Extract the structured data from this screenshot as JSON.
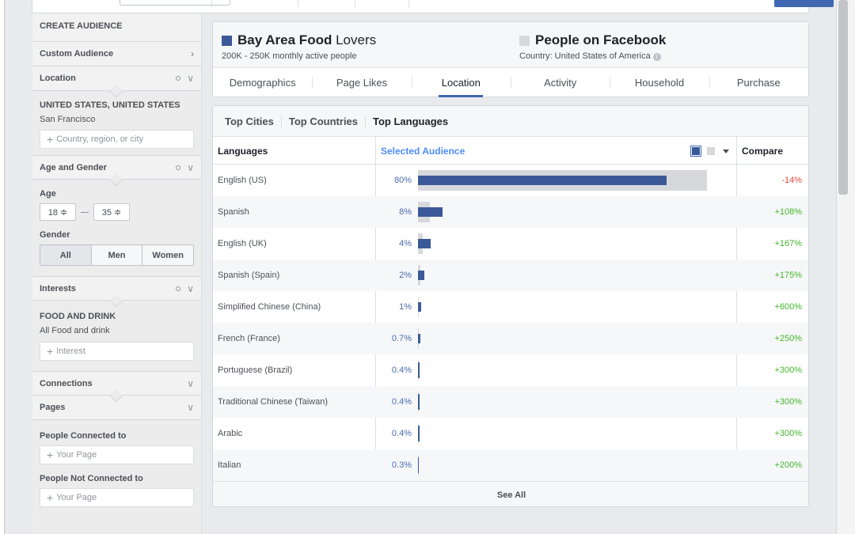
{
  "colors": {
    "selected_audience": "#3b5998",
    "comparison": "#d6d8dc",
    "accent": "#4267b2",
    "negative": "#e2473f",
    "positive": "#42b72a"
  },
  "sidebar": {
    "header": "CREATE AUDIENCE",
    "custom_audience": "Custom Audience",
    "location": {
      "label": "Location",
      "country": "UNITED STATES, UNITED STATES",
      "city": "San Francisco",
      "input_placeholder": "Country, region, or city"
    },
    "age_gender": {
      "label": "Age and Gender",
      "age_label": "Age",
      "age_min": "18 ≑",
      "age_max": "35 ≑",
      "gender_label": "Gender",
      "gender_options": [
        "All",
        "Men",
        "Women"
      ]
    },
    "interests": {
      "label": "Interests",
      "category": "FOOD AND DRINK",
      "selection": "All Food and drink",
      "input_placeholder": "Interest"
    },
    "connections": "Connections",
    "pages": {
      "label": "Pages",
      "connected_label": "People Connected to",
      "connected_placeholder": "Your Page",
      "not_connected_label": "People Not Connected to",
      "not_connected_placeholder": "Your Page"
    }
  },
  "header": {
    "audience_name_bold": "Bay Area Food",
    "audience_name_light": "Lovers",
    "audience_size": "200K - 250K monthly active people",
    "compare_name": "People on Facebook",
    "compare_country": "Country: United States of America",
    "tabs": [
      "Demographics",
      "Page Likes",
      "Location",
      "Activity",
      "Household",
      "Purchase"
    ],
    "active_tab": "Location"
  },
  "panel": {
    "subtabs": [
      "Top Cities",
      "Top Countries",
      "Top Languages"
    ],
    "active_subtab": "Top Languages",
    "col_languages": "Languages",
    "col_selected": "Selected Audience",
    "col_compare": "Compare",
    "see_all": "See All"
  },
  "chart_data": {
    "type": "bar",
    "categories": [
      "English (US)",
      "Spanish",
      "English (UK)",
      "Spanish (Spain)",
      "Simplified Chinese (China)",
      "French (France)",
      "Portuguese (Brazil)",
      "Traditional Chinese (Taiwan)",
      "Arabic",
      "Italian"
    ],
    "series": [
      {
        "name": "Selected Audience",
        "values": [
          80,
          8,
          4,
          2,
          1,
          0.7,
          0.4,
          0.4,
          0.4,
          0.3
        ]
      },
      {
        "values": [
          93,
          3.8,
          1.5,
          0.7,
          0.14,
          0.2,
          0.1,
          0.1,
          0.1,
          0.1
        ]
      }
    ],
    "labels": [
      "80%",
      "8%",
      "4%",
      "2%",
      "1%",
      "0.7%",
      "0.4%",
      "0.4%",
      "0.4%",
      "0.3%"
    ],
    "compare": [
      "-14%",
      "+108%",
      "+167%",
      "+175%",
      "+600%",
      "+250%",
      "+300%",
      "+300%",
      "+300%",
      "+200%"
    ],
    "ylim": [
      0,
      100
    ]
  }
}
